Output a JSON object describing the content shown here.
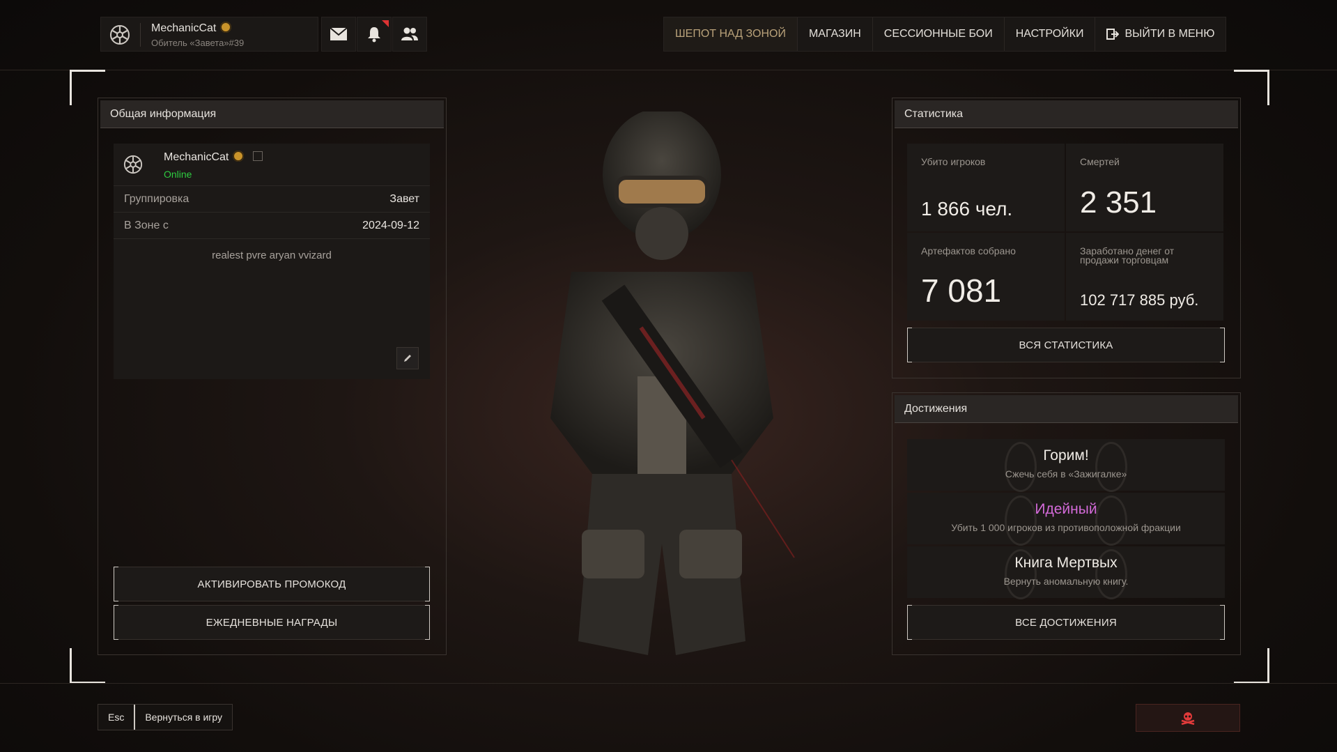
{
  "profile": {
    "name": "MechanicCat",
    "clan": "Обитель «Завета»#39"
  },
  "nav": {
    "items": [
      "ШЕПОТ НАД ЗОНОЙ",
      "МАГАЗИН",
      "СЕССИОННЫЕ БОИ",
      "НАСТРОЙКИ",
      "ВЫЙТИ В МЕНЮ"
    ],
    "active_index": 0
  },
  "info": {
    "header": "Общая информация",
    "name": "MechanicCat",
    "status": "Online",
    "faction_label": "Группировка",
    "faction_value": "Завет",
    "since_label": "В Зоне с",
    "since_value": "2024-09-12",
    "bio": "realest pvre aryan vvizard",
    "promo_button": "АКТИВИРОВАТЬ ПРОМОКОД",
    "daily_button": "ЕЖЕДНЕВНЫЕ НАГРАДЫ"
  },
  "stats": {
    "header": "Статистика",
    "kills_label": "Убито игроков",
    "kills_value": "1 866 чел.",
    "deaths_label": "Смертей",
    "deaths_value": "2 351",
    "artifacts_label": "Артефактов собрано",
    "artifacts_value": "7 081",
    "money_label_1": "Заработано денег от",
    "money_label_2": "продажи торговцам",
    "money_value": "102 717 885 руб.",
    "all_button": "ВСЯ СТАТИСТИКА"
  },
  "achievements": {
    "header": "Достижения",
    "items": [
      {
        "title": "Горим!",
        "desc": "Сжечь себя в «Зажигалке»"
      },
      {
        "title": "Идейный",
        "desc": "Убить 1 000 игроков из противоположной фракции"
      },
      {
        "title": "Книга Мертвых",
        "desc": "Вернуть аномальную книгу."
      }
    ],
    "all_button": "ВСЕ ДОСТИЖЕНИЯ"
  },
  "footer": {
    "esc_key": "Esc",
    "back_label": "Вернуться в игру"
  },
  "colors": {
    "online": "#2ecc40",
    "highlight_achievement": "#d36ad8",
    "active_nav": "#b9a27a",
    "danger": "#e03a3a"
  }
}
